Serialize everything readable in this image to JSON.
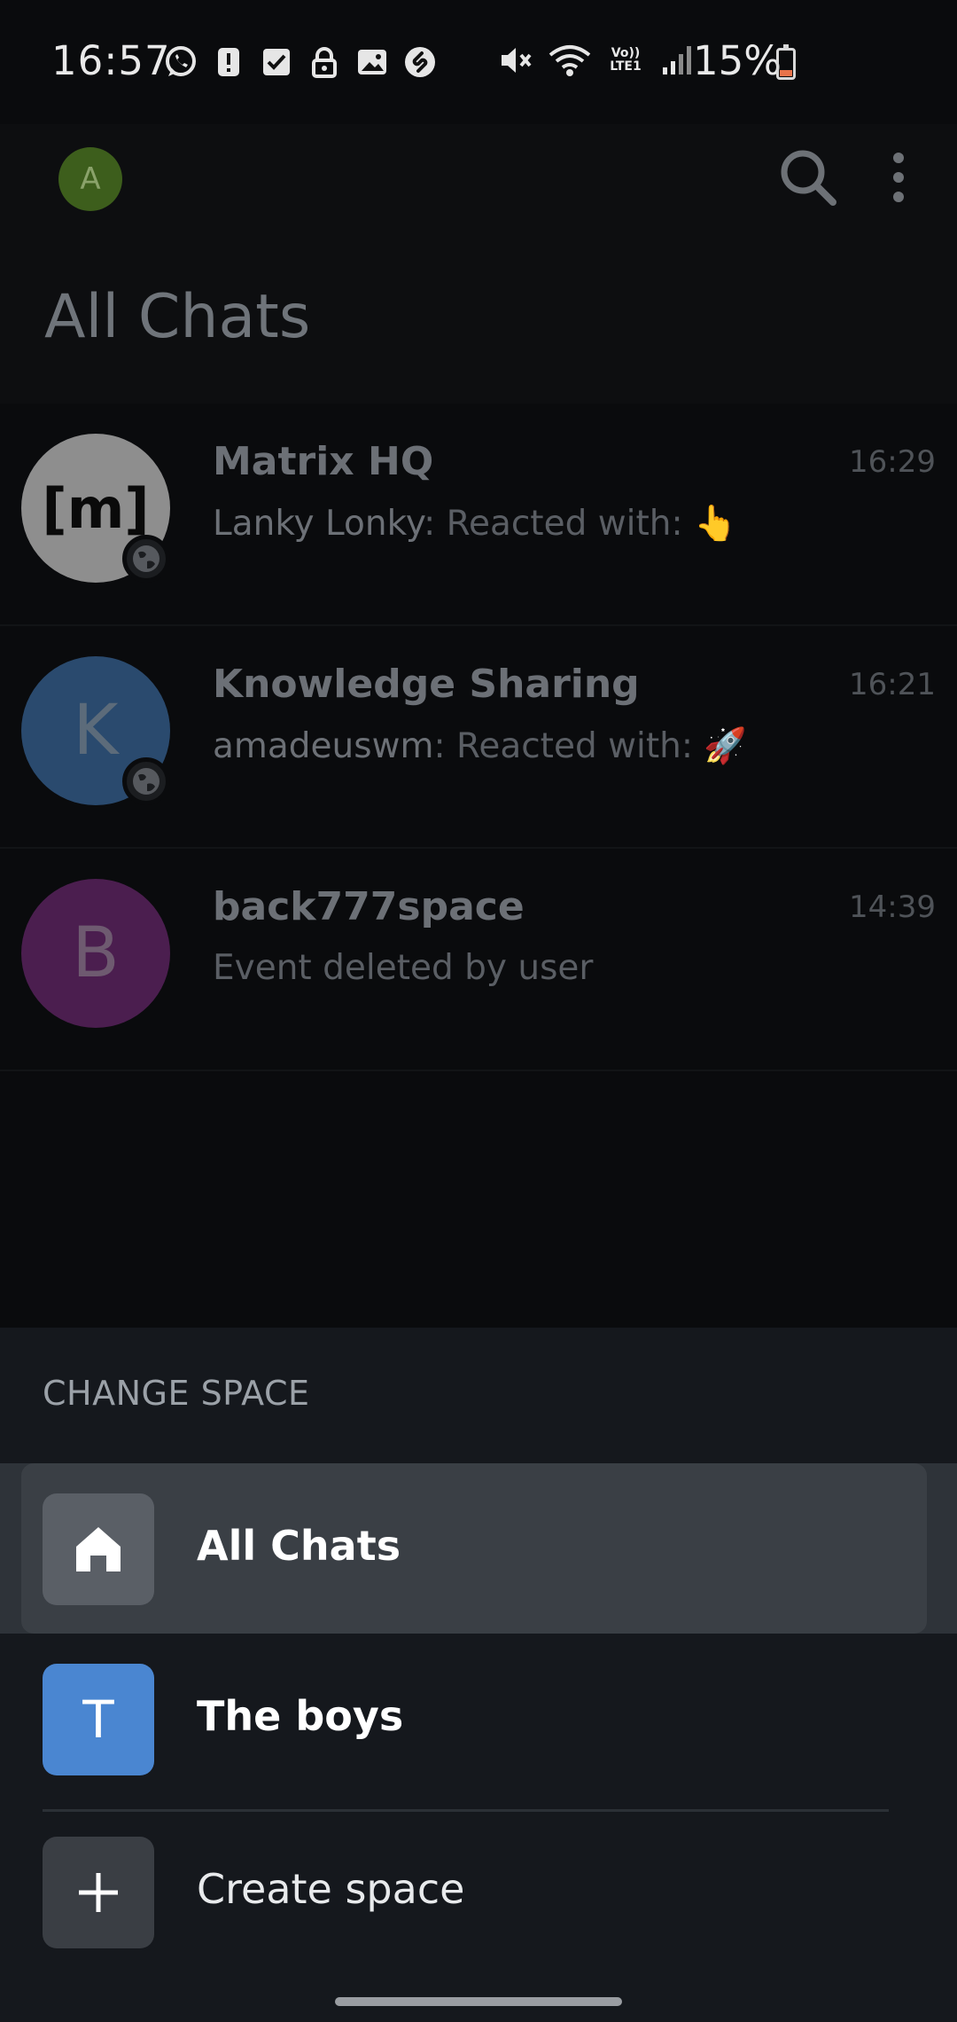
{
  "status_bar": {
    "time": "16:57",
    "battery": "15%",
    "left_icons": [
      "whatsapp-icon",
      "alert-icon",
      "checkbox-icon",
      "lock-icon",
      "image-icon",
      "shazam-icon"
    ],
    "right_icons": [
      "mute-icon",
      "wifi-icon",
      "volte-icon",
      "signal-icon"
    ],
    "volte_label": "Vo)) LTE1"
  },
  "header": {
    "avatar_initial": "A",
    "title": "All Chats"
  },
  "chats": [
    {
      "name": "Matrix HQ",
      "avatar": "[m]",
      "sender": "Lanky Lonky",
      "message": ": Reacted with: 👆",
      "time": "16:29",
      "color": "#8e8e8e",
      "has_badge": true
    },
    {
      "name": "Knowledge Sharing",
      "avatar": "K",
      "sender": "amadeuswm",
      "message": ": Reacted with: 🚀",
      "time": "16:21",
      "color": "#2a4a6e",
      "has_badge": true
    },
    {
      "name": "back777space",
      "avatar": "B",
      "sender": "",
      "message": "Event deleted by user",
      "time": "14:39",
      "color": "#4b1e4f",
      "has_badge": false
    }
  ],
  "sheet": {
    "header": "CHANGE SPACE",
    "items": [
      {
        "label": "All Chats",
        "icon": "home-icon",
        "selected": true
      },
      {
        "label": "The boys",
        "icon_letter": "T",
        "color": "#4a86d1"
      },
      {
        "label": "Create space",
        "icon": "plus-icon"
      }
    ]
  }
}
